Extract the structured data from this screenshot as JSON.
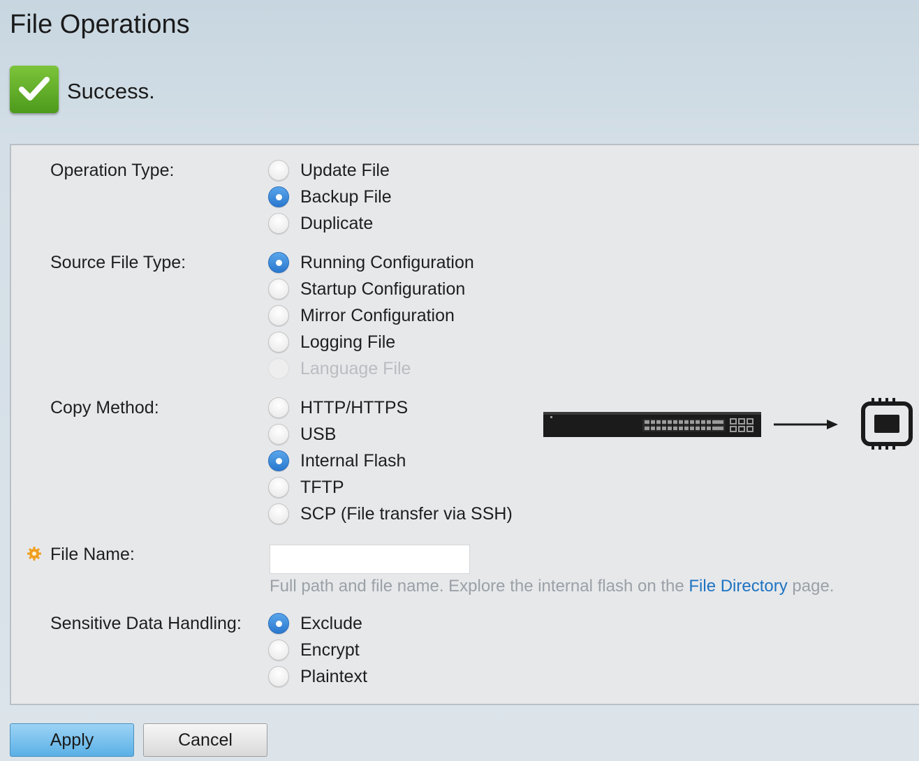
{
  "page": {
    "title": "File Operations"
  },
  "status": {
    "message": "Success.",
    "icon": "checkmark-icon",
    "color": "#5fae26"
  },
  "form": {
    "operation_type": {
      "label": "Operation Type:",
      "options": [
        "Update File",
        "Backup File",
        "Duplicate"
      ],
      "selected": "Backup File"
    },
    "source_file_type": {
      "label": "Source File Type:",
      "options": [
        "Running Configuration",
        "Startup Configuration",
        "Mirror Configuration",
        "Logging File",
        "Language File"
      ],
      "selected": "Running Configuration",
      "disabled": [
        "Language File"
      ]
    },
    "copy_method": {
      "label": "Copy Method:",
      "options": [
        "HTTP/HTTPS",
        "USB",
        "Internal Flash",
        "TFTP",
        "SCP (File transfer via SSH)"
      ],
      "selected": "Internal Flash"
    },
    "file_name": {
      "label": "File Name:",
      "value": "",
      "required": true,
      "hint_before": "Full path and file name. Explore the internal flash on the ",
      "hint_link": "File Directory",
      "hint_after": " page."
    },
    "sensitive_data_handling": {
      "label": "Sensitive Data Handling:",
      "options": [
        "Exclude",
        "Encrypt",
        "Plaintext"
      ],
      "selected": "Exclude"
    }
  },
  "diagram": {
    "from_icon": "switch-device-icon",
    "arrow_icon": "arrow-right-icon",
    "to_icon": "flash-chip-icon"
  },
  "buttons": {
    "apply": "Apply",
    "cancel": "Cancel"
  },
  "colors": {
    "radio_selected": "#2f80d3",
    "link": "#1d73c2",
    "required_marker": "#f0a020",
    "apply_button": "#6cbbec"
  }
}
